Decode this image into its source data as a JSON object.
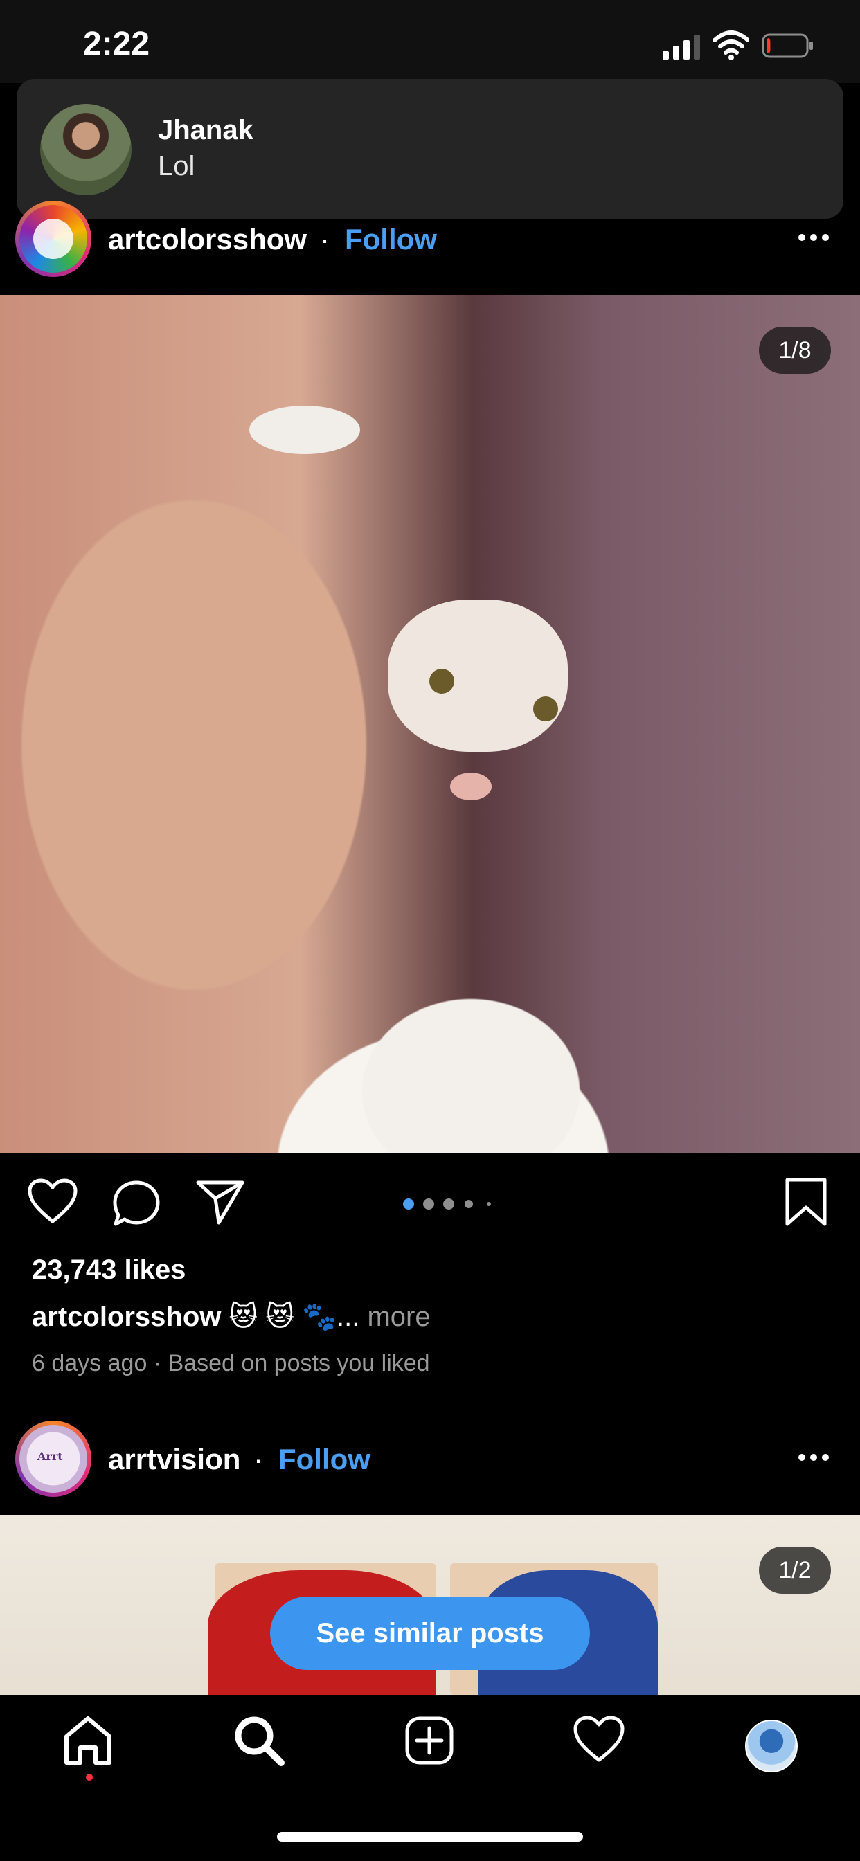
{
  "status_bar": {
    "time": "2:22",
    "signal_icon": "cellular-signal-icon",
    "wifi_icon": "wifi-icon",
    "battery_icon": "battery-low-icon",
    "battery_level": 0.1
  },
  "notification": {
    "sender": "Jhanak",
    "message": "Lol"
  },
  "posts": [
    {
      "username": "artcolorsshow",
      "separator": "·",
      "follow_label": "Follow",
      "photo_counter": "1/8",
      "carousel_dots": 5,
      "carousel_active": 0,
      "likes": "23,743 likes",
      "caption_user": "artcolorsshow",
      "caption_text": "😻 😻 🐾",
      "caption_ellipsis": "...",
      "caption_more": "more",
      "meta": "6 days ago · Based on posts you liked"
    },
    {
      "username": "arrtvision",
      "separator": "·",
      "follow_label": "Follow",
      "photo_counter": "1/2"
    }
  ],
  "see_similar_label": "See similar posts",
  "bottom_nav": {
    "items": [
      "home-icon",
      "search-icon",
      "new-post-icon",
      "activity-heart-icon",
      "profile-avatar"
    ]
  },
  "colors": {
    "accent": "#4a9ff5",
    "button_blue": "#3c95ef",
    "background": "#000000",
    "banner": "#252525",
    "muted_text": "#9a9a9a"
  }
}
